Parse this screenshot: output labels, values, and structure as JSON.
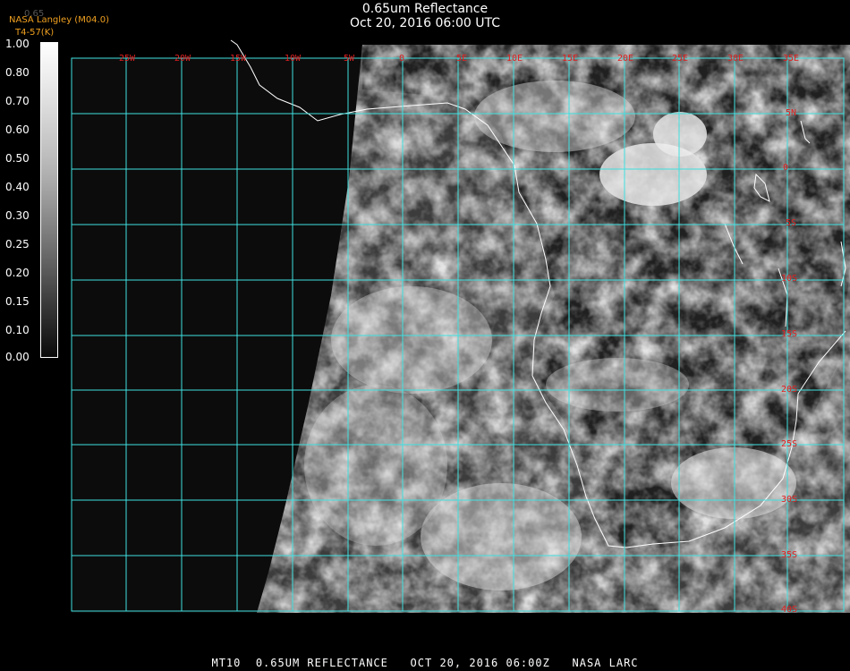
{
  "header": {
    "title": "0.65um Reflectance",
    "subtitle": "Oct 20, 2016 06:00 UTC"
  },
  "credit": {
    "line1": "NASA Langley (M04.0)",
    "line2": "T4-57(K)",
    "faint_value": "0.65"
  },
  "colorbar": {
    "ticks": [
      "1.00",
      "0.80",
      "0.70",
      "0.60",
      "0.50",
      "0.40",
      "0.30",
      "0.25",
      "0.20",
      "0.15",
      "0.10",
      "0.00"
    ]
  },
  "map": {
    "lon_labels": [
      "25W",
      "20W",
      "15W",
      "10W",
      "5W",
      "0",
      "5E",
      "10E",
      "15E",
      "20E",
      "25E",
      "30E",
      "35E"
    ],
    "lat_labels": [
      "5N",
      "0",
      "5S",
      "10S",
      "15S",
      "20S",
      "25S",
      "30S",
      "35S",
      "40S"
    ],
    "grid_color": "#40e0e0",
    "label_color": "#e02020"
  },
  "footer": {
    "text": "MT10  0.65UM REFLECTANCE   OCT 20, 2016 06:00Z   NASA LARC"
  }
}
